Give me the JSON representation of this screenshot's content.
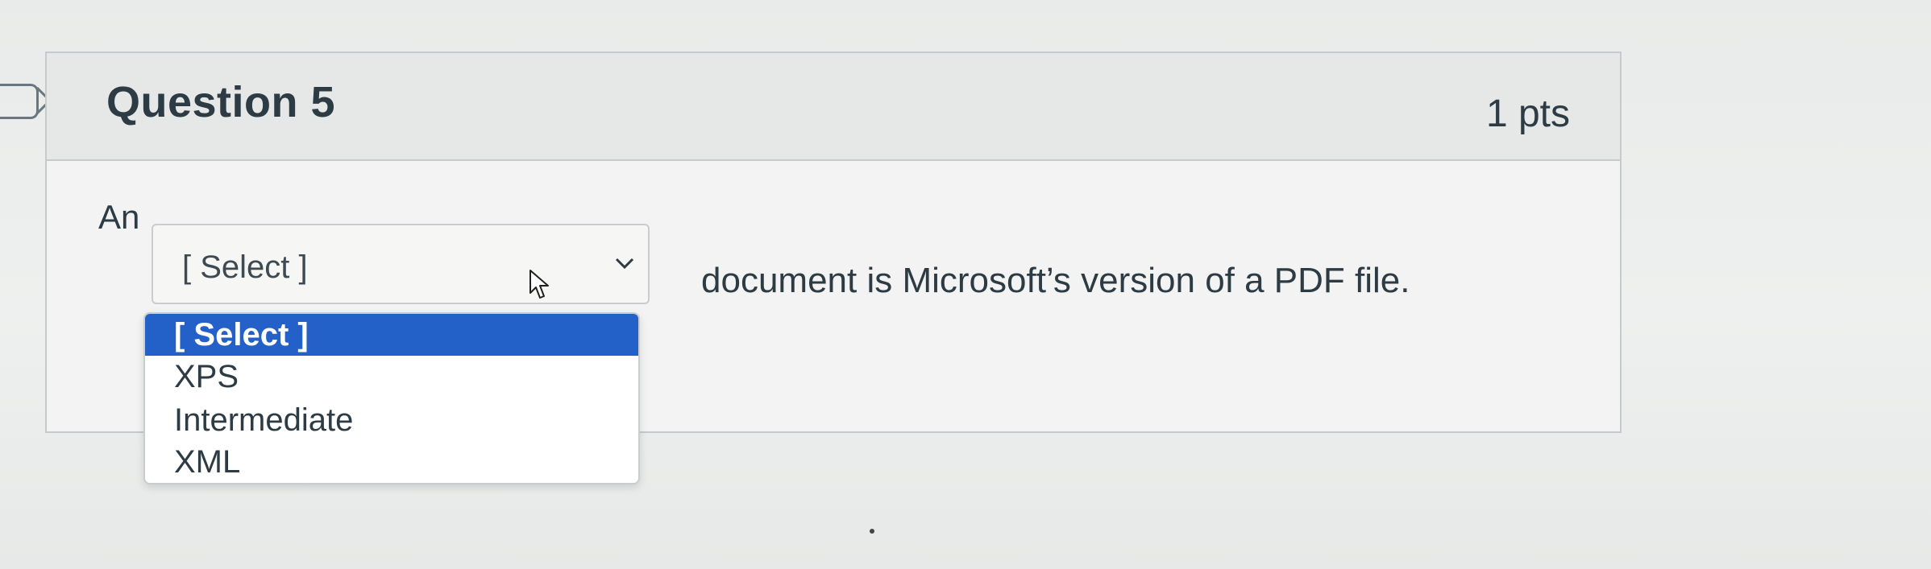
{
  "question": {
    "title": "Question 5",
    "points": "1 pts",
    "prefix": "An",
    "suffix": "document is Microsoft’s version of a PDF file."
  },
  "select": {
    "current_value": "[ Select ]",
    "options": [
      "[ Select ]",
      "XPS",
      "Intermediate",
      "XML"
    ],
    "highlighted_option": "[ Select ]"
  },
  "colors": {
    "highlight": "#2361c9",
    "text": "#2d3b45"
  },
  "icons": {
    "caret": "chevron-down-icon",
    "cursor": "mouse-pointer-icon",
    "bookmark": "bookmark-flag-icon"
  }
}
